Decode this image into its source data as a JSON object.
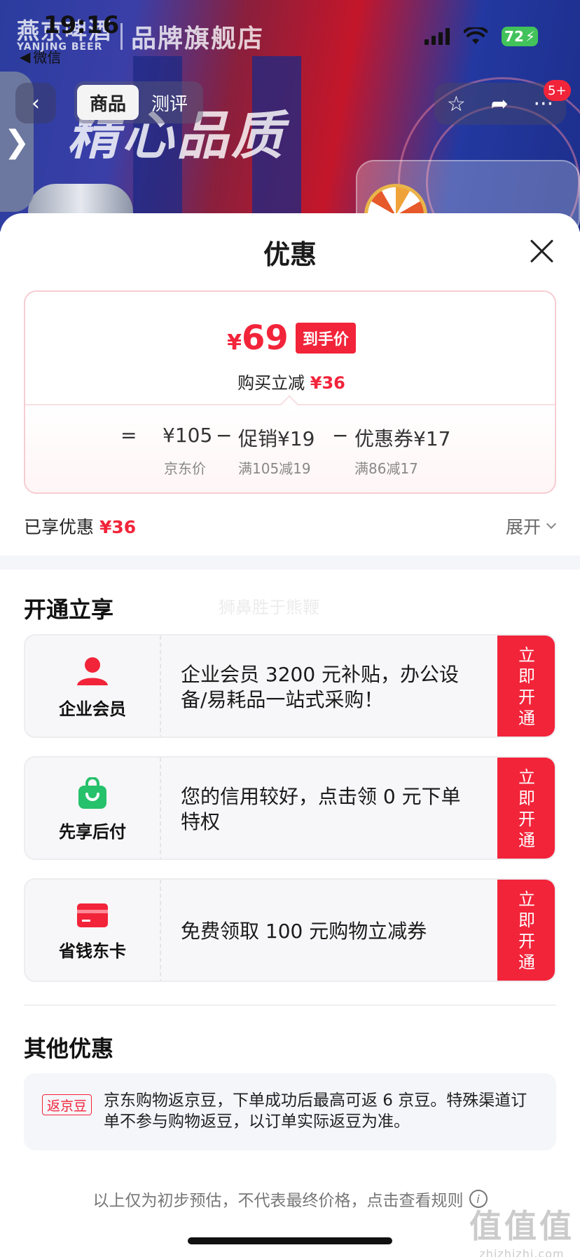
{
  "status_bar": {
    "time": "19:16",
    "back_app": "微信",
    "battery": "72"
  },
  "product_bg": {
    "brand_cn": "燕京啤酒",
    "brand_en": "YANJING BEER",
    "brand_title": "品牌旗舰店",
    "slogan": "精心品质"
  },
  "nav": {
    "tabs": [
      {
        "label": "商品",
        "active": true
      },
      {
        "label": "测评",
        "active": false
      }
    ],
    "message_badge": "5+",
    "icons": [
      "star-icon",
      "share-icon",
      "more-icon"
    ]
  },
  "sheet": {
    "title": "优惠",
    "price": {
      "symbol": "¥",
      "amount": "69",
      "tag": "到手价",
      "save_prefix": "购买立减",
      "save_amount": "¥36"
    },
    "breakdown": {
      "equals": "=",
      "base": {
        "value": "¥105",
        "label": "京东价"
      },
      "minus1": "−",
      "promo": {
        "value": "促销¥19",
        "label": "满105减19"
      },
      "minus2": "−",
      "coupon": {
        "value": "优惠券¥17",
        "label": "满86减17"
      }
    },
    "enjoyed_label": "已享优惠",
    "enjoyed_amount": "¥36",
    "expand_label": "展开"
  },
  "open_section": {
    "title": "开通立享",
    "watermark": "狮鼻胜于熊鞭",
    "offers": [
      {
        "name": "企业会员",
        "icon": "person-icon",
        "desc": "企业会员 3200 元补贴，办公设备/易耗品一站式采购！",
        "button": "立即开通"
      },
      {
        "name": "先享后付",
        "icon": "shopping-bag-icon",
        "desc": "您的信用较好，点击领 0 元下单特权",
        "button": "立即开通"
      },
      {
        "name": "省钱东卡",
        "icon": "card-icon",
        "desc": "免费领取 100 元购物立减券",
        "button": "立即开通"
      }
    ]
  },
  "other_section": {
    "title": "其他优惠",
    "bean_tag": "返京豆",
    "bean_text": "京东购物返京豆，下单成功后最高可返 6 京豆。特殊渠道订单不参与购物返豆，以订单实际返豆为准。"
  },
  "footer": {
    "note": "以上仅为初步预估，不代表最终价格，点击查看规则",
    "site_mark": "值值值",
    "site_url": "zhizhizhi.com"
  },
  "colors": {
    "accent_red": "#f2243a",
    "green": "#26c16b"
  }
}
